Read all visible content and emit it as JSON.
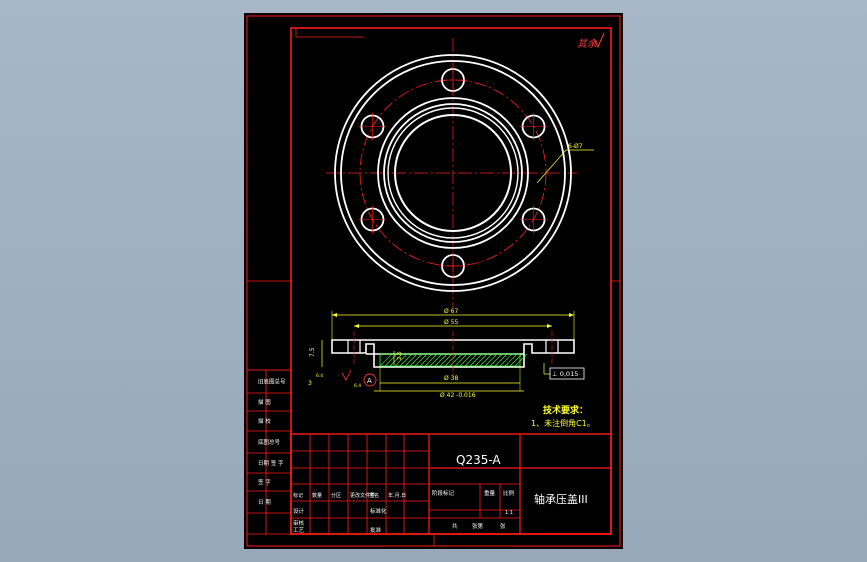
{
  "colors": {
    "frame": "#ff1a1a",
    "outline": "#ffffff",
    "dimension": "#ffff33",
    "hatch": "#33ff33",
    "center": "#ff2020",
    "background": "#000000"
  },
  "stamp": "其余",
  "dims": {
    "hole_dia": "6-Ø7",
    "od": "Ø 67",
    "bolt_circle": "Ø 55",
    "height": "7.5",
    "thickness": "2.5",
    "flange_step": "2.5",
    "chamfer": "3",
    "bore": "Ø 38",
    "spigot": "Ø 42 -0.016",
    "datum": "A",
    "perp_tol": "⊥ 0,015",
    "surface_marks": [
      "6.4",
      "6.4"
    ]
  },
  "tech": {
    "title": "技术要求：",
    "item1": "1、未注倒角C1。"
  },
  "title_block": {
    "material": "Q235-A",
    "part_name": "轴承压盖III",
    "scale": "1:1",
    "left_col": [
      "旧底图总号",
      "描 图",
      "描 校",
      "底图总号",
      "日期 签 字",
      "签 字",
      "日 期"
    ],
    "mark_row": [
      "标记",
      "数量",
      "分区",
      "更改文件号",
      "签名",
      "年.月.日"
    ],
    "row2": [
      "设计",
      "",
      "标准化"
    ],
    "row3": [
      "审核",
      "",
      "",
      "",
      "",
      ""
    ],
    "row4": [
      "工艺",
      "",
      "批准"
    ],
    "stage": [
      "阶段标记",
      "重量",
      "比例"
    ],
    "sheet": [
      "共",
      "张第",
      "张"
    ]
  }
}
